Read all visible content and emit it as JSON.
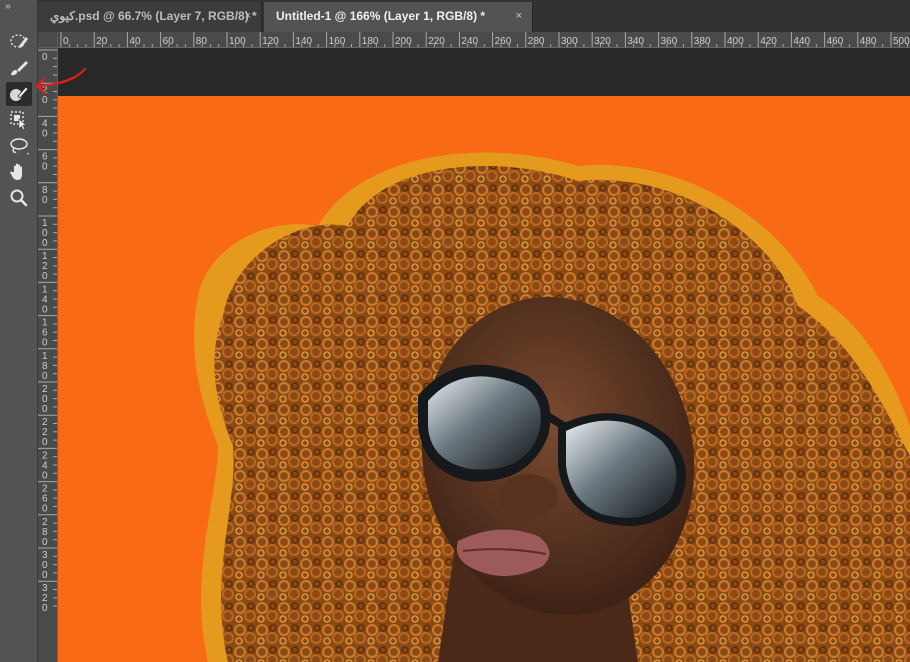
{
  "tabs": [
    {
      "label": "كيوي.psd @ 66.7% (Layer 7, RGB/8) *",
      "close": "×"
    },
    {
      "label": "Untitled-1 @ 166% (Layer 1, RGB/8) *",
      "close": "×"
    }
  ],
  "toolbar": {
    "grip": "››",
    "tools": [
      {
        "name": "quick-selection-tool",
        "icon": "quick-selection-icon"
      },
      {
        "name": "brush-tool",
        "icon": "brush-icon"
      },
      {
        "name": "object-brush-tool",
        "icon": "object-brush-icon",
        "active": true
      },
      {
        "name": "object-selection-tool",
        "icon": "object-selection-icon"
      },
      {
        "name": "lasso-tool",
        "icon": "lasso-icon"
      },
      {
        "name": "hand-tool",
        "icon": "hand-icon"
      },
      {
        "name": "zoom-tool",
        "icon": "zoom-icon"
      }
    ]
  },
  "ruler": {
    "horizontal": [
      "0",
      "20",
      "40",
      "60",
      "80",
      "100",
      "120",
      "140",
      "160",
      "180",
      "200",
      "220",
      "240",
      "260",
      "280",
      "300",
      "320",
      "340",
      "360",
      "380",
      "400",
      "420",
      "440",
      "460",
      "480",
      "500"
    ],
    "vertical": [
      "0",
      "2 0",
      "4 0",
      "6 0",
      "8 0",
      "1 0 0",
      "1 2 0",
      "1 4 0",
      "1 6 0",
      "1 8 0",
      "2 0 0",
      "2 2 0",
      "2 4 0",
      "2 6 0",
      "2 8 0",
      "3 0 0",
      "3 2 0"
    ]
  },
  "colors": {
    "canvas_background": "#f96a14",
    "annotation_arrow": "#d9201a",
    "active_tab": "#535353"
  }
}
